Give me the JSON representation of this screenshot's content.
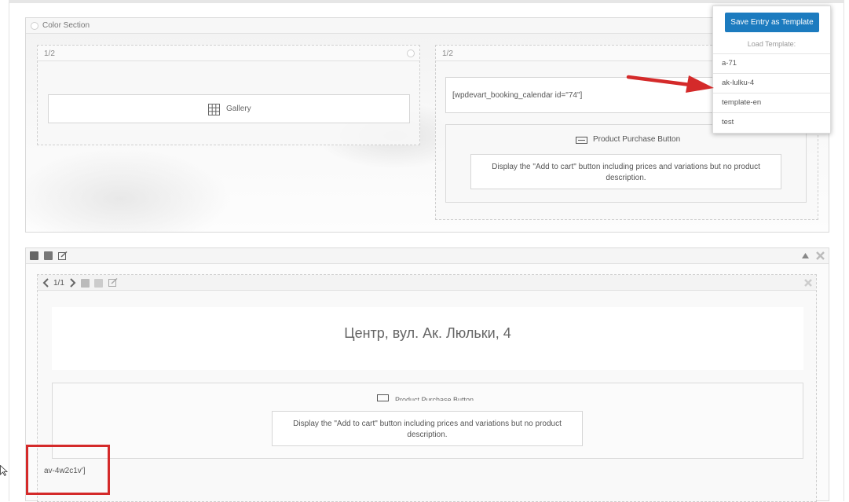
{
  "color_section": {
    "title": "Color Section",
    "left_column": {
      "size": "1/2",
      "gallery_label": "Gallery"
    },
    "right_column": {
      "size": "1/2",
      "shortcode": "[wpdevart_booking_calendar id=\"74\"]",
      "purchase_title": "Product Purchase Button",
      "purchase_desc": "Display the \"Add to cart\" button including prices and variations but no product description."
    }
  },
  "row_section": {
    "pager": "1/1",
    "heading": "Центр, вул. Ак. Люльки, 4",
    "purchase_title": "Product Purchase Button",
    "purchase_desc": "Display the \"Add to cart\" button including prices and variations but no product description.",
    "code_fragment": "av-4w2c1v']"
  },
  "template_menu": {
    "save_label": "Save Entry as Template",
    "load_label": "Load Template:",
    "items": [
      "a-71",
      "ak-lulku-4",
      "template-en",
      "test"
    ]
  },
  "colors": {
    "accent": "#1c7bbf",
    "annotation": "#d42a2a"
  }
}
